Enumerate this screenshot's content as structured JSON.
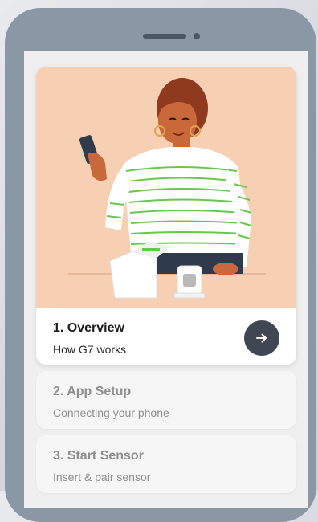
{
  "steps": [
    {
      "title": "1. Overview",
      "subtitle": "How G7 works",
      "state": "active"
    },
    {
      "title": "2. App Setup",
      "subtitle": "Connecting your phone",
      "state": "inactive"
    },
    {
      "title": "3. Start Sensor",
      "subtitle": "Insert & pair sensor",
      "state": "inactive"
    }
  ],
  "icons": {
    "next": "arrow-right-icon"
  },
  "colors": {
    "illustration_bg": "#f7cfb2",
    "button_bg": "#3f4753",
    "stripe_green": "#67c84e",
    "phone_frame": "#8a97a5"
  }
}
